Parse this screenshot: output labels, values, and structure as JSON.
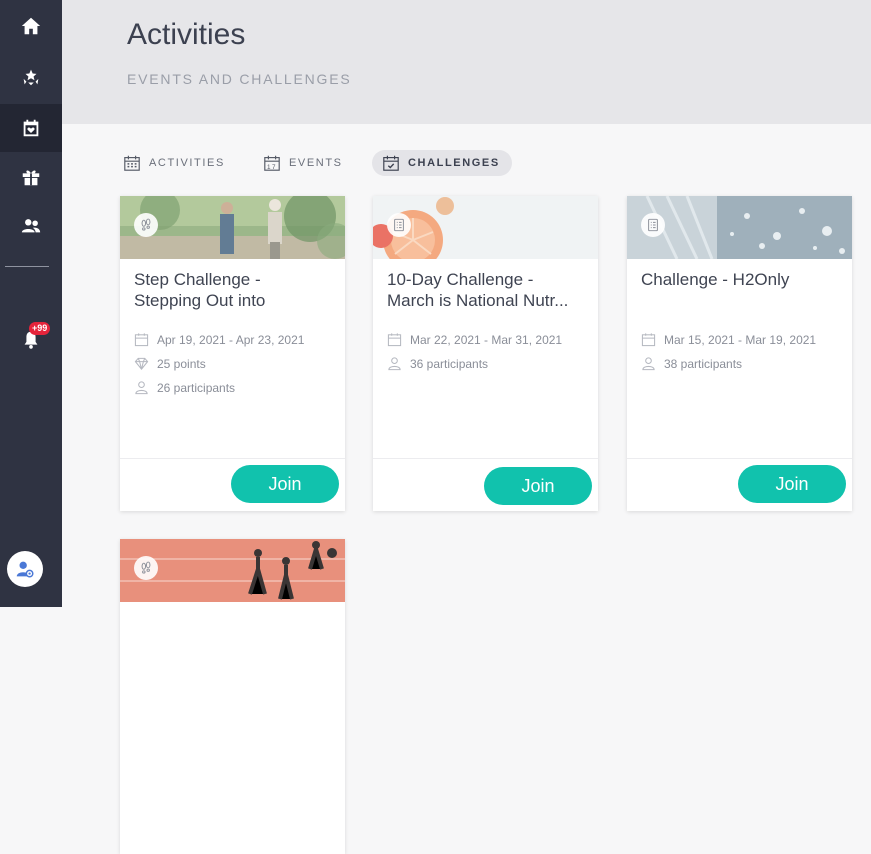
{
  "sidebar": {
    "items": [
      {
        "name": "home-icon"
      },
      {
        "name": "rewards-icon"
      },
      {
        "name": "activities-icon"
      },
      {
        "name": "gift-icon"
      },
      {
        "name": "people-icon"
      },
      {
        "name": "bell-icon"
      }
    ],
    "notification_badge": "+99"
  },
  "header": {
    "title": "Activities",
    "subtitle": "EVENTS AND CHALLENGES"
  },
  "tabs": [
    {
      "label": "ACTIVITIES",
      "icon": "calendar-grid-icon"
    },
    {
      "label": "EVENTS",
      "icon": "calendar-17-icon"
    },
    {
      "label": "CHALLENGES",
      "icon": "calendar-check-icon",
      "active": true
    }
  ],
  "cards": [
    {
      "title_line1": "Step Challenge -",
      "title_line2": "Stepping Out into",
      "type_icon": "footsteps-icon",
      "dates": "Apr 19, 2021 - Apr 23, 2021",
      "points": "25 points",
      "participants": "26 participants",
      "join_label": "Join"
    },
    {
      "title_line1": "10-Day Challenge -",
      "title_line2": "March is National Nutr...",
      "type_icon": "checklist-icon",
      "dates": "Mar 22, 2021 - Mar 31, 2021",
      "participants": "36 participants",
      "join_label": "Join"
    },
    {
      "title_line1": "Challenge - H2Only",
      "type_icon": "checklist-icon",
      "dates": "Mar 15, 2021 - Mar 19, 2021",
      "participants": "38 participants",
      "join_label": "Join"
    },
    {
      "type_icon": "footsteps-icon"
    }
  ],
  "colors": {
    "sidebar": "#2f3342",
    "accent": "#11c2ad",
    "badge": "#e5243b"
  }
}
